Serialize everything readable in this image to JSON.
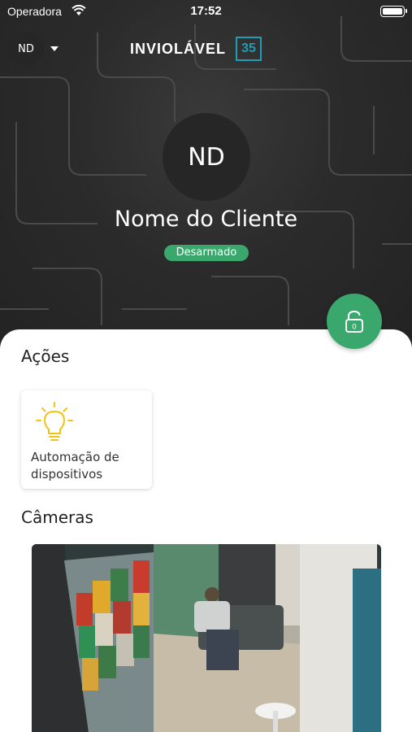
{
  "status_bar": {
    "carrier": "Operadora",
    "time": "17:52"
  },
  "header": {
    "account_initials": "ND",
    "logo_text": "INVIOLÁVEL",
    "logo_badge": "35"
  },
  "profile": {
    "initials": "ND",
    "name": "Nome do Cliente",
    "status": "Desarmado"
  },
  "lock_button": {
    "count": "0"
  },
  "actions": {
    "title": "Ações",
    "items": [
      {
        "label": "Automação de dispositivos",
        "icon": "lightbulb-icon"
      }
    ]
  },
  "cameras": {
    "title": "Câmeras"
  },
  "colors": {
    "accent_green": "#3aa76d",
    "bulb_yellow": "#f2c40f",
    "logo_blue": "#1e9fb6",
    "hero_dark": "#2b2b2b"
  }
}
